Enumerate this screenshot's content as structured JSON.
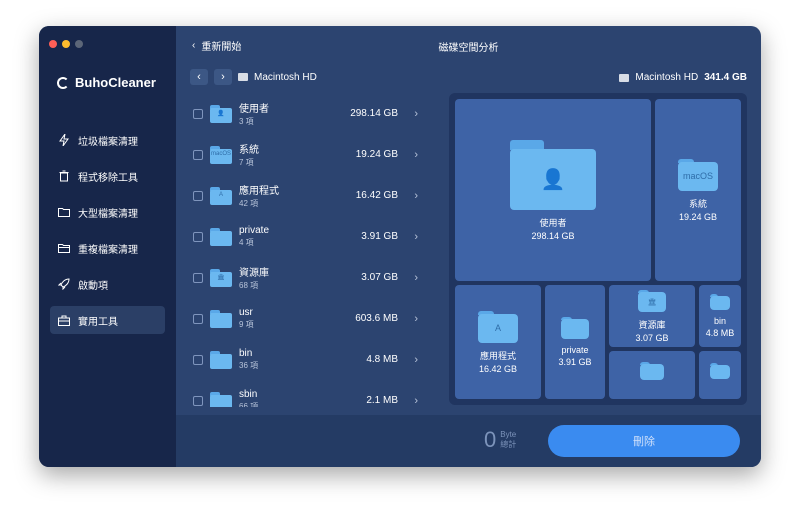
{
  "app": {
    "name": "BuhoCleaner"
  },
  "sidebar": {
    "items": [
      {
        "label": "垃圾檔案清理",
        "icon": "bolt-icon"
      },
      {
        "label": "程式移除工具",
        "icon": "trash-icon"
      },
      {
        "label": "大型檔案清理",
        "icon": "folder-icon"
      },
      {
        "label": "重複檔案清理",
        "icon": "folders-icon"
      },
      {
        "label": "啟動項",
        "icon": "rocket-icon"
      },
      {
        "label": "實用工具",
        "icon": "toolbox-icon",
        "active": true
      }
    ]
  },
  "topbar": {
    "back_label": "重新開始",
    "title": "磁碟空間分析"
  },
  "path": {
    "current": "Macintosh HD"
  },
  "disk": {
    "name": "Macintosh HD",
    "size": "341.4 GB"
  },
  "list": [
    {
      "name": "使用者",
      "count": "3 項",
      "size": "298.14 GB",
      "glyph": "👤"
    },
    {
      "name": "系統",
      "count": "7 項",
      "size": "19.24 GB",
      "glyph": "macOS"
    },
    {
      "name": "應用程式",
      "count": "42 項",
      "size": "16.42 GB",
      "glyph": "A"
    },
    {
      "name": "private",
      "count": "4 項",
      "size": "3.91 GB",
      "glyph": ""
    },
    {
      "name": "資源庫",
      "count": "68 項",
      "size": "3.07 GB",
      "glyph": "🏛"
    },
    {
      "name": "usr",
      "count": "9 項",
      "size": "603.6 MB",
      "glyph": ""
    },
    {
      "name": "bin",
      "count": "36 項",
      "size": "4.8 MB",
      "glyph": ""
    },
    {
      "name": "sbin",
      "count": "66 項",
      "size": "2.1 MB",
      "glyph": ""
    }
  ],
  "treemap": [
    {
      "name": "使用者",
      "size": "298.14 GB",
      "glyph": "👤"
    },
    {
      "name": "系統",
      "size": "19.24 GB",
      "glyph": "macOS"
    },
    {
      "name": "應用程式",
      "size": "16.42 GB",
      "glyph": "A"
    },
    {
      "name": "private",
      "size": "3.91 GB",
      "glyph": ""
    },
    {
      "name": "資源庫",
      "size": "3.07 GB",
      "glyph": "🏛"
    },
    {
      "name": "bin",
      "size": "4.8 MB",
      "glyph": ""
    },
    {
      "name": "",
      "size": "",
      "glyph": ""
    },
    {
      "name": "",
      "size": "",
      "glyph": ""
    }
  ],
  "bottom": {
    "count": "0",
    "unit": "Byte",
    "total_label": "總計",
    "delete_label": "刪除"
  },
  "colors": {
    "accent": "#3a8bf0",
    "sidebar": "#17264a",
    "main": "#2c4470",
    "cell": "#3e63a6"
  }
}
